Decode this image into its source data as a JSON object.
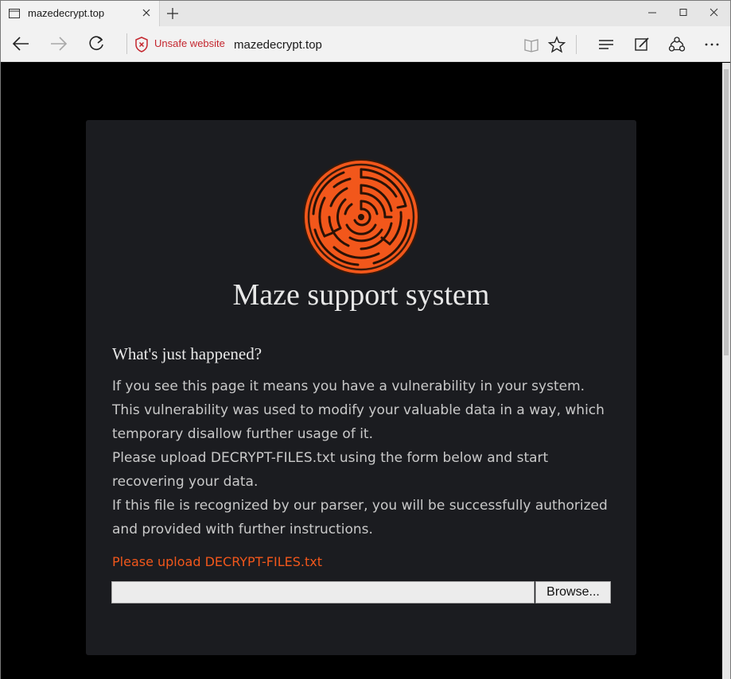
{
  "browser": {
    "tab_title": "mazedecrypt.top",
    "security_label": "Unsafe website",
    "url": "mazedecrypt.top"
  },
  "page": {
    "title": "Maze support system",
    "heading": "What's just happened?",
    "paragraph_lines": [
      "If you see this page it means you have a vulnerability in your system.",
      "This vulnerability was used to modify your valuable data in a way, which",
      "temporary disallow further usage of it.",
      "Please upload DECRYPT-FILES.txt using the form below and start",
      "recovering your data.",
      "If this file is recognized by our parser, you will be successfully authorized",
      "and provided with further instructions."
    ],
    "upload_label": "Please upload DECRYPT-FILES.txt",
    "browse_label": "Browse..."
  },
  "colors": {
    "accent": "#f2571b",
    "unsafe": "#c4262e",
    "panel": "#1b1c20"
  }
}
